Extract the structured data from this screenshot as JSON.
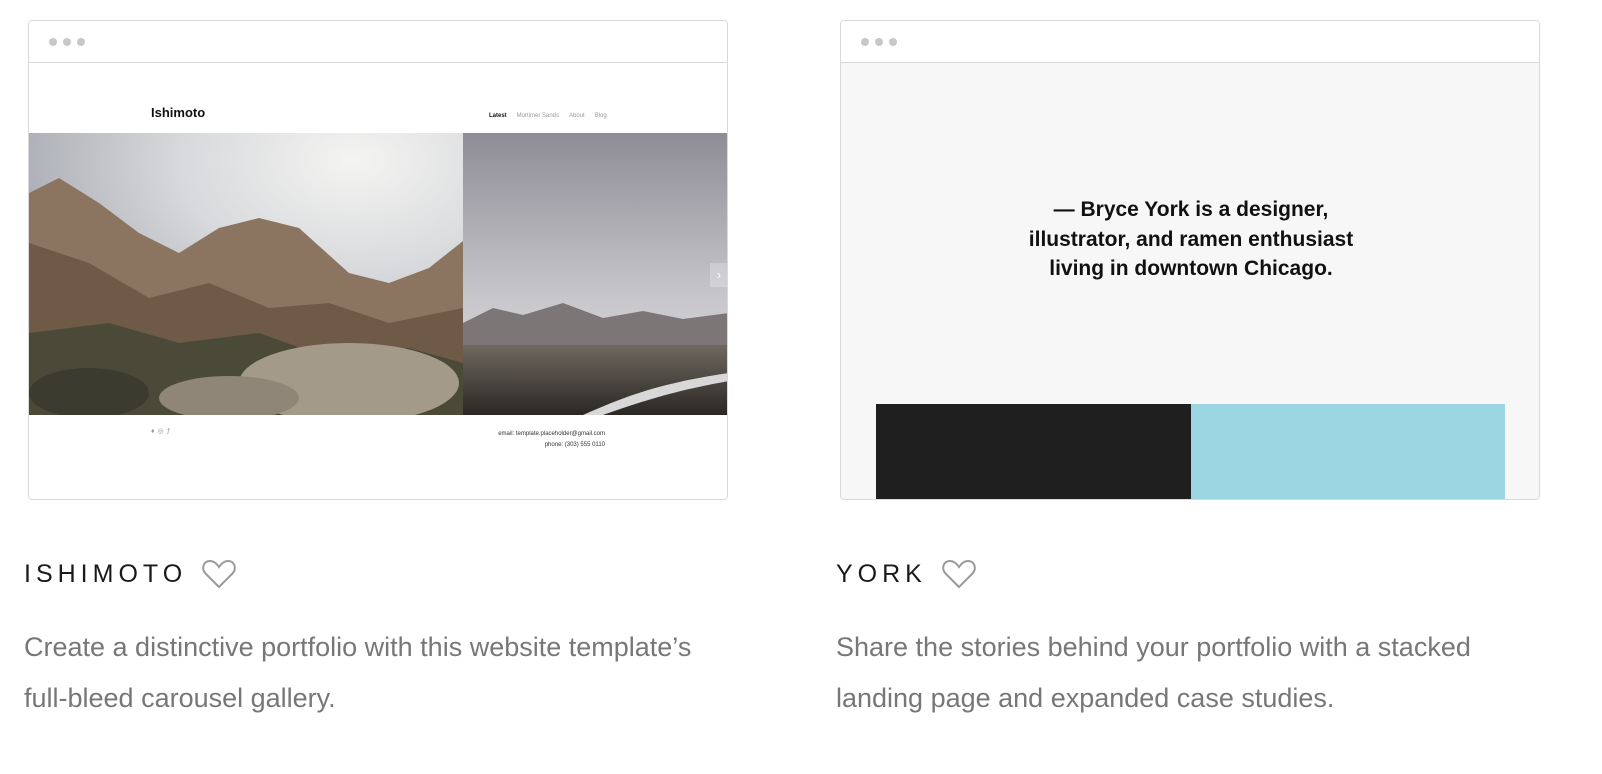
{
  "templates": [
    {
      "name": "ISHIMOTO",
      "description": "Create a distinctive portfolio with this website template’s full-bleed carousel gallery.",
      "preview": {
        "site_title": "Ishimoto",
        "nav": [
          "Latest",
          "Mortimer Sands",
          "About",
          "Blog"
        ],
        "email": "email: template.placeholder@gmail.com",
        "phone": "phone: (303) 555 0110"
      }
    },
    {
      "name": "YORK",
      "description": "Share the stories behind your portfolio with a stacked landing page and expanded case studies.",
      "preview": {
        "quote_lines": [
          "— Bryce York is a designer,",
          "illustrator, and ramen enthusiast",
          "living in downtown Chicago."
        ],
        "colors": {
          "dark": "#1f1f1f",
          "blue": "#9dd6e3"
        }
      }
    }
  ]
}
